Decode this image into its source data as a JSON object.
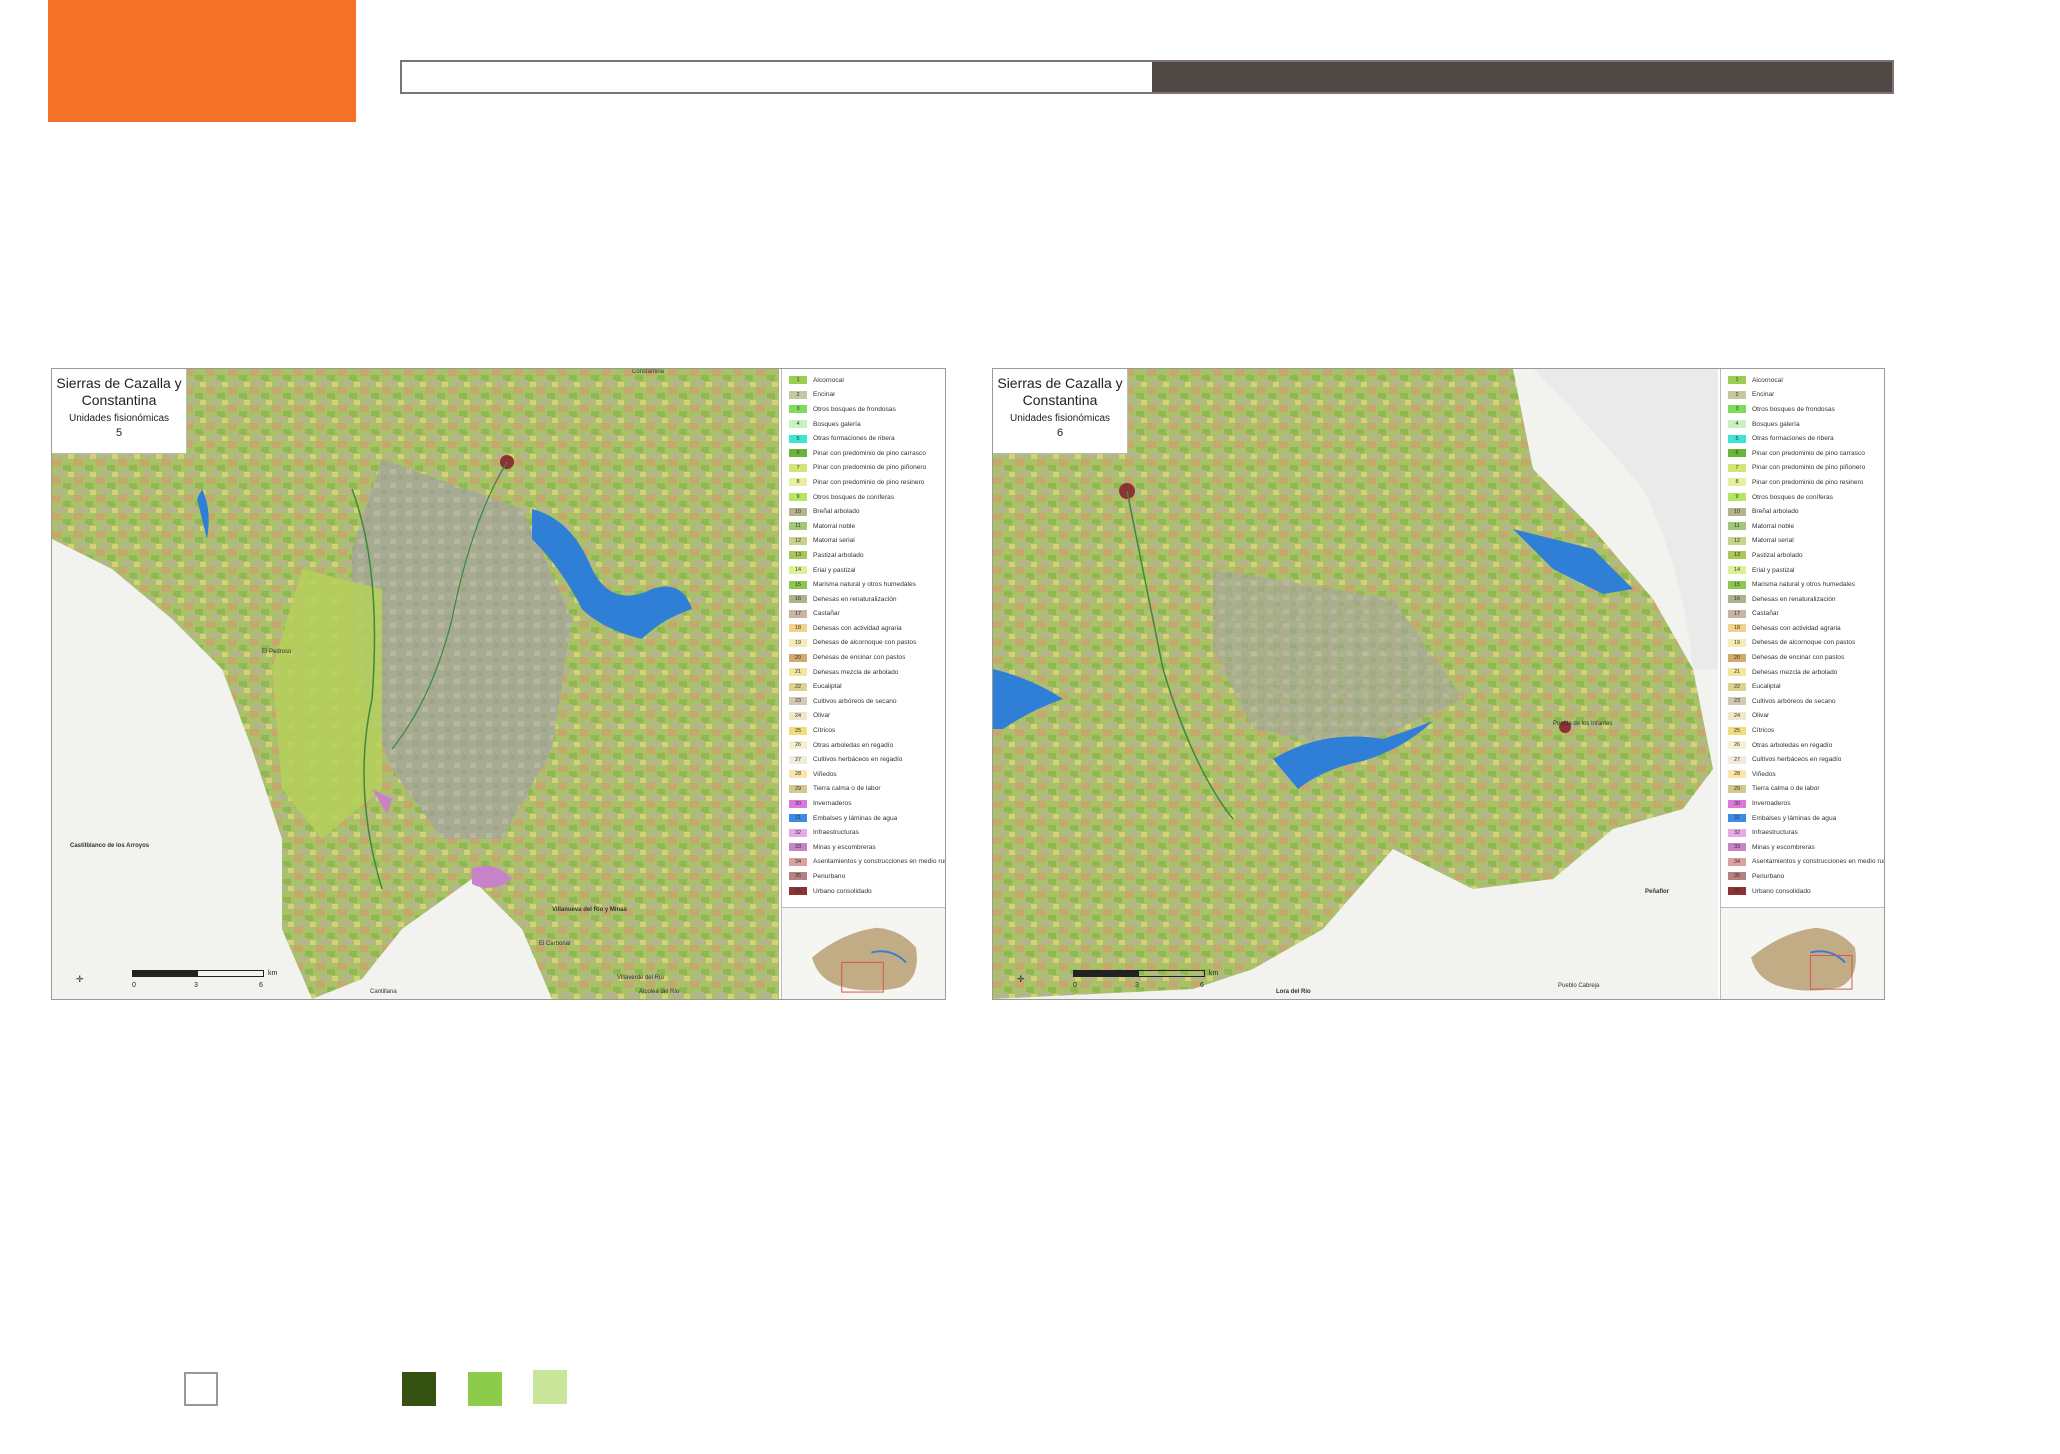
{
  "maps": [
    {
      "id": "map5",
      "title": "Sierras de Cazalla y Constantina",
      "subtitle": "Unidades fisionómicas",
      "number": "5",
      "places": [
        "Constantina",
        "Villanueva del Río y Minas",
        "Castilblanco de los Arroyos",
        "El Pedroso",
        "Cantillana",
        "Alcolea del Río",
        "Villaverde del Río",
        "El Carbonal"
      ],
      "scale": {
        "zero": "0",
        "mid": "3",
        "end": "6",
        "unit": "km"
      }
    },
    {
      "id": "map6",
      "title": "Sierras de Cazalla y Constantina",
      "subtitle": "Unidades fisionómicas",
      "number": "6",
      "places": [
        "Puebla de los Infantes",
        "Lora del Río",
        "Peñaflor",
        "Pueblo Cabreja"
      ],
      "scale": {
        "zero": "0",
        "mid": "3",
        "end": "6",
        "unit": "km"
      }
    }
  ],
  "legend": [
    {
      "n": "1",
      "label": "Alcornocal",
      "color": "#9acd50"
    },
    {
      "n": "2",
      "label": "Encinar",
      "color": "#c8c8a0"
    },
    {
      "n": "3",
      "label": "Otros bosques de frondosas",
      "color": "#7ddc5a"
    },
    {
      "n": "4",
      "label": "Bosques galería",
      "color": "#c8f0c0"
    },
    {
      "n": "5",
      "label": "Otras formaciones de ribera",
      "color": "#3ce6d2"
    },
    {
      "n": "6",
      "label": "Pinar con predominio de pino carrasco",
      "color": "#6ab43c"
    },
    {
      "n": "7",
      "label": "Pinar con predominio de pino piñonero",
      "color": "#d2e678"
    },
    {
      "n": "8",
      "label": "Pinar con predominio de pino resinero",
      "color": "#e6f0a0"
    },
    {
      "n": "9",
      "label": "Otros bosques de coníferas",
      "color": "#b4e664"
    },
    {
      "n": "10",
      "label": "Breñal arbolado",
      "color": "#b4b48c"
    },
    {
      "n": "11",
      "label": "Matorral noble",
      "color": "#a0c878"
    },
    {
      "n": "12",
      "label": "Matorral serial",
      "color": "#c8d28c"
    },
    {
      "n": "13",
      "label": "Pastizal arbolado",
      "color": "#aac85a"
    },
    {
      "n": "14",
      "label": "Erial y pastizal",
      "color": "#dcf096"
    },
    {
      "n": "15",
      "label": "Marisma natural y otros humedales",
      "color": "#8cc850"
    },
    {
      "n": "16",
      "label": "Dehesas en renaturalización",
      "color": "#aab48c"
    },
    {
      "n": "17",
      "label": "Castañar",
      "color": "#c8b4a0"
    },
    {
      "n": "18",
      "label": "Dehesas con actividad agraria",
      "color": "#f0d28c"
    },
    {
      "n": "19",
      "label": "Dehesas de alcornoque con pastos",
      "color": "#f5ebb4"
    },
    {
      "n": "20",
      "label": "Dehesas de encinar con pastos",
      "color": "#d2aa6e"
    },
    {
      "n": "21",
      "label": "Dehesas mezcla de arbolado",
      "color": "#f0e6a0"
    },
    {
      "n": "22",
      "label": "Eucaliptal",
      "color": "#dcd28c"
    },
    {
      "n": "23",
      "label": "Cultivos arbóreos de secano",
      "color": "#d2c8b4"
    },
    {
      "n": "24",
      "label": "Olivar",
      "color": "#f0e6c8"
    },
    {
      "n": "25",
      "label": "Cítricos",
      "color": "#f0dc78"
    },
    {
      "n": "26",
      "label": "Otras arboledas en regadío",
      "color": "#f5f0d2"
    },
    {
      "n": "27",
      "label": "Cultivos herbáceos en regadío",
      "color": "#f0ebdc"
    },
    {
      "n": "28",
      "label": "Viñedos",
      "color": "#fae6aa"
    },
    {
      "n": "29",
      "label": "Tierra calma o de labor",
      "color": "#d2c88c"
    },
    {
      "n": "30",
      "label": "Invernaderos",
      "color": "#dc78dc"
    },
    {
      "n": "31",
      "label": "Embalses y láminas de agua",
      "color": "#3c8ce6"
    },
    {
      "n": "32",
      "label": "Infraestructuras",
      "color": "#e6aae6"
    },
    {
      "n": "33",
      "label": "Minas y escombreras",
      "color": "#c882c8"
    },
    {
      "n": "34",
      "label": "Asentamientos y construcciones en medio rural",
      "color": "#dca0a0"
    },
    {
      "n": "35",
      "label": "Periurbano",
      "color": "#b48282"
    },
    {
      "n": "36",
      "label": "Urbano consolidado",
      "color": "#8c3232"
    }
  ],
  "colors": {
    "header_accent": "#f47128",
    "header_bar_dark": "#4f4845",
    "swatch_dark_green": "#355212",
    "swatch_mid_green": "#8dcb4b",
    "swatch_light_green": "#c8e59a"
  }
}
